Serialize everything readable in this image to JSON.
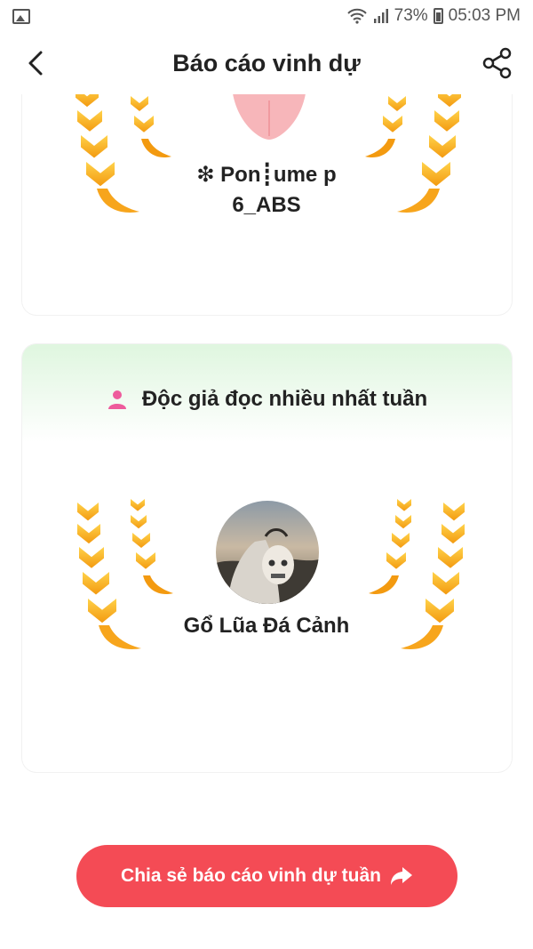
{
  "status_bar": {
    "battery": "73%",
    "time": "05:03 PM"
  },
  "header": {
    "title": "Báo cáo vinh dự",
    "back_icon": "chevron-left-icon",
    "share_icon": "share-icon"
  },
  "top_card": {
    "user_name": "❇ Pon┋ume p​6_ABS"
  },
  "reader_card": {
    "title": "Độc giả đọc nhiều nhất tuần",
    "title_icon": "person-icon",
    "user_name": "Gổ Lũa Đá Cảnh"
  },
  "share_button": {
    "label": "Chia sẻ báo cáo vinh dự tuần",
    "icon": "share-arrow-icon"
  },
  "colors": {
    "accent": "#f44b55",
    "laurel": "#f7a51c",
    "reader_header_bg": "#dff6df",
    "person_icon": "#ee5b9c"
  }
}
